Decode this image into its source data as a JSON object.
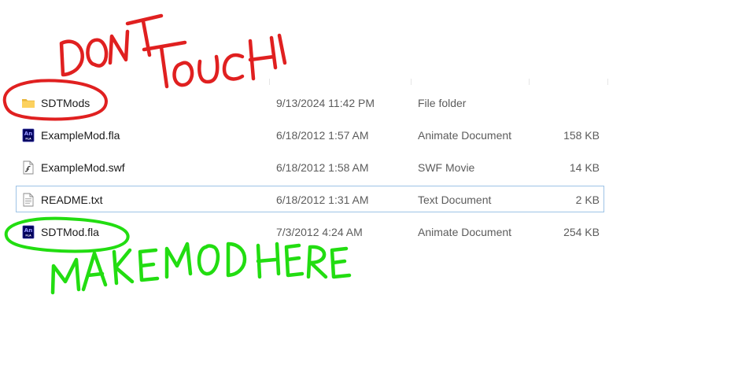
{
  "files": [
    {
      "name": "SDTMods",
      "date": "9/13/2024 11:42 PM",
      "type": "File folder",
      "size": "",
      "icon": "folder-icon"
    },
    {
      "name": "ExampleMod.fla",
      "date": "6/18/2012 1:57 AM",
      "type": "Animate Document",
      "size": "158 KB",
      "icon": "animate-document-icon"
    },
    {
      "name": "ExampleMod.swf",
      "date": "6/18/2012 1:58 AM",
      "type": "SWF Movie",
      "size": "14 KB",
      "icon": "swf-movie-icon"
    },
    {
      "name": "README.txt",
      "date": "6/18/2012 1:31 AM",
      "type": "Text Document",
      "size": "2 KB",
      "icon": "text-document-icon"
    },
    {
      "name": "SDTMod.fla",
      "date": "7/3/2012 4:24 AM",
      "type": "Animate Document",
      "size": "254 KB",
      "icon": "animate-document-icon"
    }
  ],
  "annotations": {
    "red_text": "DONT TOUCH",
    "green_text": "MAKE MOD HERE",
    "red_color": "#e02020",
    "green_color": "#22dd11"
  }
}
